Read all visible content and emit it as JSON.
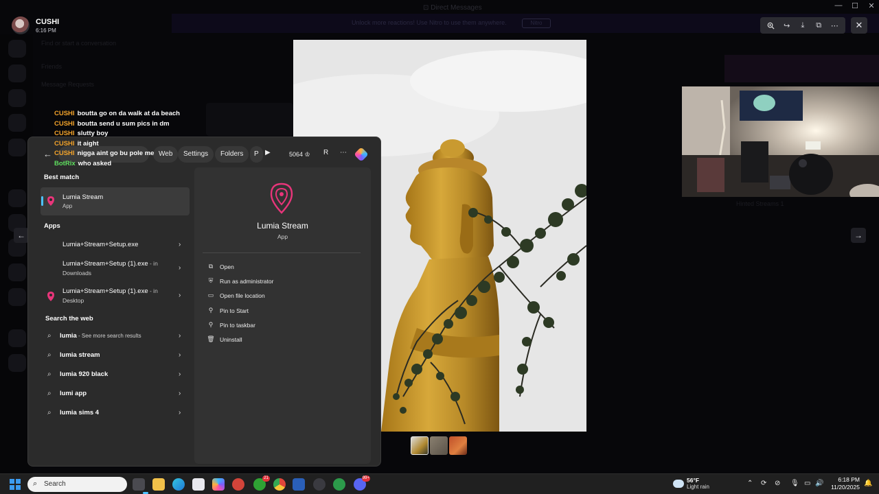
{
  "viewer": {
    "username": "CUSHI",
    "time": "6:16 PM",
    "toolbar_icons": [
      "zoom-in-icon",
      "forward-icon",
      "download-icon",
      "open-external-icon",
      "more-icon"
    ],
    "close_label": "✕"
  },
  "background_app": {
    "banner_text": "Unlock more reactions! Use Nitro to use them anywhere.",
    "banner_button": "Nitro"
  },
  "stream_chat": [
    {
      "user": "CUSHI",
      "message": "boutta go on da walk at da beach",
      "bot": false
    },
    {
      "user": "CUSHI",
      "message": "boutta send u sum pics in dm",
      "bot": false
    },
    {
      "user": "CUSHI",
      "message": "slutty boy",
      "bot": false
    },
    {
      "user": "CUSHI",
      "message": "it aight",
      "bot": false
    },
    {
      "user": "CUSHI",
      "message": "nigga aint go bu pole me",
      "bot": false
    },
    {
      "user": "BotRix",
      "message": "who asked",
      "bot": true
    }
  ],
  "search_panel": {
    "tabs": [
      "Web",
      "Settings",
      "Folders",
      "P"
    ],
    "points": "5064",
    "profile_initial": "R",
    "best_match_title": "Best match",
    "best_match": {
      "name": "Lumia Stream",
      "type": "App"
    },
    "apps_title": "Apps",
    "apps": [
      {
        "name": "Lumia+Stream+Setup.exe",
        "location": "",
        "sub": ""
      },
      {
        "name": "Lumia+Stream+Setup (1).exe",
        "location": " - in",
        "sub": "Downloads"
      },
      {
        "name": "Lumia+Stream+Setup (1).exe",
        "location": " - in",
        "sub": "Desktop"
      }
    ],
    "web_title": "Search the web",
    "web_results": [
      {
        "query": "lumia",
        "more": " - See more search results"
      },
      {
        "query": "lumia stream",
        "more": ""
      },
      {
        "query": "lumia 920 black",
        "more": ""
      },
      {
        "query": "lumi app",
        "more": ""
      },
      {
        "query": "lumia sims 4",
        "more": ""
      }
    ],
    "detail": {
      "name": "Lumia Stream",
      "type": "App",
      "actions": [
        {
          "label": "Open",
          "icon": "open-icon"
        },
        {
          "label": "Run as administrator",
          "icon": "shield-icon"
        },
        {
          "label": "Open file location",
          "icon": "folder-icon"
        },
        {
          "label": "Pin to Start",
          "icon": "pin-icon"
        },
        {
          "label": "Pin to taskbar",
          "icon": "pin-icon"
        },
        {
          "label": "Uninstall",
          "icon": "trash-icon"
        }
      ]
    }
  },
  "taskbar": {
    "search_placeholder": "Search",
    "weather_temp": "56°F",
    "weather_desc": "Light rain",
    "clock_time": "6:18 PM",
    "clock_date": "11/20/2025",
    "xbox_badge": "21",
    "discord_badge": "99+"
  },
  "colors": {
    "accent": "#4cc2ff",
    "chat_user": "#f3a32a",
    "chat_bot": "#5fe05f",
    "lumia_pink": "#e8357a"
  }
}
